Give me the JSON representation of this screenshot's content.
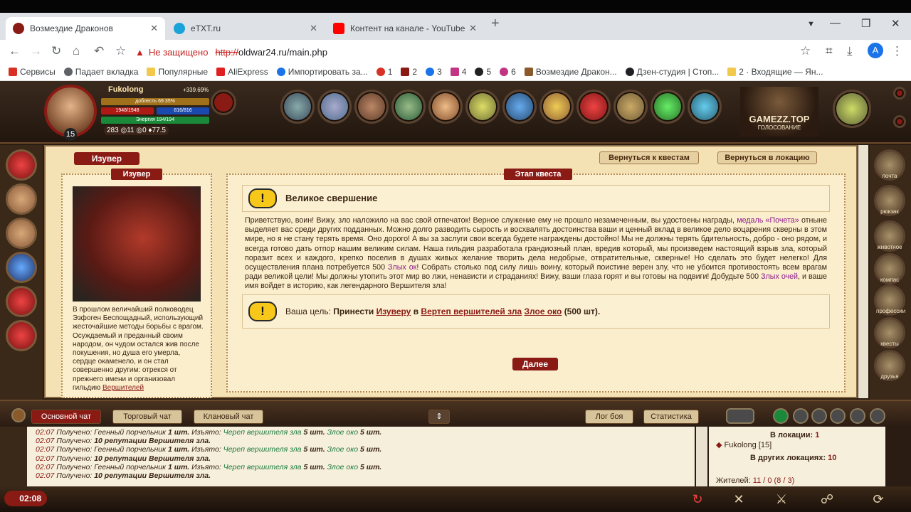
{
  "browser": {
    "tabs": [
      {
        "title": "Возмездие Драконов",
        "fav_color": "#8a1a14"
      },
      {
        "title": "eTXT.ru",
        "fav_color": "#1aa3d9"
      },
      {
        "title": "Контент на канале - YouTube St",
        "fav_color": "#ff0000"
      }
    ],
    "new_tab_icon": "+",
    "not_secure": "Не защищено",
    "url_scheme": "http://",
    "url_rest": "oldwar24.ru/main.php",
    "profile_initial": "A",
    "bookmarks": [
      {
        "label": "Сервисы",
        "icon_color": "#d93025"
      },
      {
        "label": "Падает вкладка",
        "icon_color": "#5f6368"
      },
      {
        "label": "Популярные",
        "icon_color": "#f2c94c"
      },
      {
        "label": "AliExpress",
        "icon_color": "#e02020"
      },
      {
        "label": "Импортировать за...",
        "icon_color": "#1a73e8"
      },
      {
        "label": "1",
        "icon_color": "#d93025"
      },
      {
        "label": "2",
        "icon_color": "#8a1a14"
      },
      {
        "label": "3",
        "icon_color": "#1a73e8"
      },
      {
        "label": "4",
        "icon_color": "#c13584"
      },
      {
        "label": "5",
        "icon_color": "#202124"
      },
      {
        "label": "6",
        "icon_color": "#c13584"
      },
      {
        "label": "Возмездие Дракон...",
        "icon_color": "#8a5a2a"
      },
      {
        "label": "Дзен-студия | Стоп...",
        "icon_color": "#202124"
      },
      {
        "label": "2 · Входящие — Ян...",
        "icon_color": "#f2c94c"
      }
    ]
  },
  "player": {
    "name": "Fukolong",
    "exp_pct": "+339.69%",
    "level": "15",
    "bar_valor": "доблесть 69.35%",
    "bar_hp": "1948/1948",
    "bar_mp": "816/816",
    "bar_energy": "Энергия 194/194",
    "stats": "283 ◎11 ◎0 ♦77.5"
  },
  "gamezz": {
    "title": "GAMEZZ.TOP",
    "sub": "ГОЛОСОВАНИЕ"
  },
  "page": {
    "heading": "Изувер",
    "btn_quests": "Вернуться к квестам",
    "btn_location": "Вернуться в локацию"
  },
  "npc": {
    "label": "Изувер",
    "desc": "В прошлом величайший полководец Эзфоген Беспощадный, использующий жесточайшие методы борьбы с врагом. Осуждаемый и преданный своим народом, он чудом остался жив после покушения, но душа его умерла, сердце окаменело, и он стал совершенно другим: отрекся от прежнего имени и организовал гильдию ",
    "desc_link": "Вершителей"
  },
  "quest": {
    "stage_label": "Этап квеста",
    "title": "Великое свершение",
    "text_a": "Приветствую, воин! Вижу, зло наложило на вас свой отпечаток! Верное служение ему не прошло незамеченным, вы удостоены награды, ",
    "text_medal": "медаль «Почета»",
    "text_b": " отныне выделяет вас среди других подданных. Можно долго разводить сырость и восхвалять достоинства ваши и ценный вклад в великое дело воцарения скверны в этом мире, но я не стану терять время. Оно дорого! А вы за заслуги свои всегда будете награждены достойно! Мы не должны терять бдительность, добро - оно рядом, и всегда готово дать отпор нашим великим силам. Наша гильдия разработала грандиозный план, вредив который, мы произведем настоящий взрыв зла, который поразит всех и каждого, крепко поселив в душах живых желание творить дела недобрые, отвратительные, скверные! Но сделать это будет нелегко! Для осуществления плана потребуется 500 ",
    "text_evil1": "Злых ок",
    "text_c": "! Собрать столько под силу лишь воину, который поистине верен злу, что не убоится противостоять всем врагам ради великой цели! Мы должны утопить этот мир во лжи, ненависти и страданиях! Вижу, ваши глаза горят и вы готовы на подвиги! Добудьте 500 ",
    "text_evil2": "Злых очей",
    "text_d": ", и ваше имя войдет в историю, как легендарного Вершителя зла!",
    "goal_label": "Ваша цель:",
    "goal_1": "Принести",
    "goal_npc": "Изуверу",
    "goal_2": "в",
    "goal_place": "Вертеп вершителей зла",
    "goal_item": "Злое око",
    "goal_3": "(500 шт).",
    "next_label": "Далее"
  },
  "chat": {
    "tabs": [
      "Основной чат",
      "Торговый чат",
      "Клановый чат"
    ],
    "btn_log": "Лог боя",
    "btn_stats": "Статистика",
    "lines": [
      {
        "time": "02:07",
        "a": " Получено: Геенный порчельник ",
        "b": "1 шт.",
        "c": " Изъято: ",
        "d": "Череп вершителя зла ",
        "e": "5 шт.",
        "f": " Злое око ",
        "g": "5 шт."
      },
      {
        "time": "02:07",
        "a": " Получено: ",
        "b": "10 репутации Вершителя зла.",
        "c": "",
        "d": "",
        "e": "",
        "f": "",
        "g": ""
      },
      {
        "time": "02:07",
        "a": " Получено: Геенный порчельник ",
        "b": "1 шт.",
        "c": " Изъято: ",
        "d": "Череп вершителя зла ",
        "e": "5 шт.",
        "f": " Злое око ",
        "g": "5 шт."
      },
      {
        "time": "02:07",
        "a": " Получено: ",
        "b": "10 репутации Вершителя зла.",
        "c": "",
        "d": "",
        "e": "",
        "f": "",
        "g": ""
      },
      {
        "time": "02:07",
        "a": " Получено: Геенный порчельник ",
        "b": "1 шт.",
        "c": " Изъято: ",
        "d": "Череп вершителя зла ",
        "e": "5 шт.",
        "f": " Злое око ",
        "g": "5 шт."
      },
      {
        "time": "02:07",
        "a": " Получено: ",
        "b": "10 репутации Вершителя зла.",
        "c": "",
        "d": "",
        "e": "",
        "f": "",
        "g": ""
      }
    ]
  },
  "online": {
    "in_loc_label": "В локации:",
    "in_loc_count": "1",
    "player_line": "Fukolong [15]",
    "other_label": "В других локациях:",
    "other_count": "10",
    "residents_label": "Жителей:",
    "residents_value": "11 / 0 (8 / 3)"
  },
  "clock": "02:08",
  "right_menu": [
    "почта",
    "рюкзак",
    "животное",
    "компас",
    "профессии",
    "квесты",
    "друзья"
  ]
}
